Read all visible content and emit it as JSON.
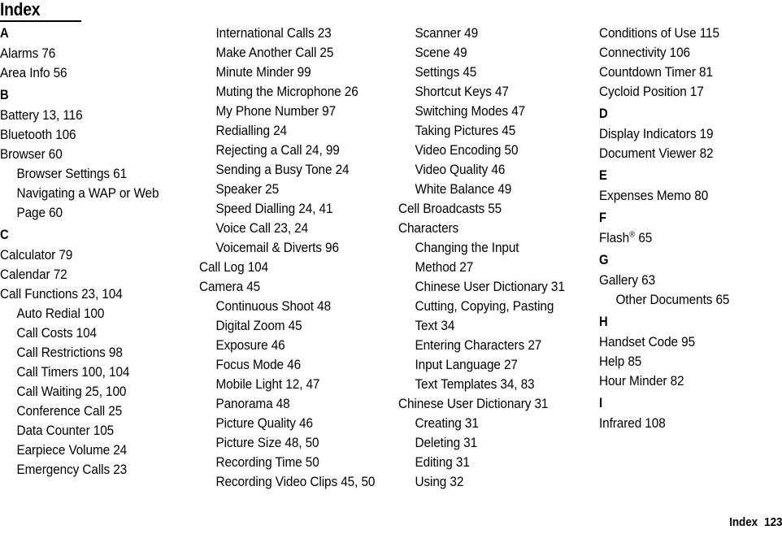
{
  "page": {
    "title": "Index",
    "footer_label": "Index",
    "footer_page": "123"
  },
  "columns": [
    {
      "id": "column-1",
      "blocks": [
        {
          "type": "letter",
          "text": "A"
        },
        {
          "type": "entry",
          "level": 0,
          "text": "Alarms 76"
        },
        {
          "type": "entry",
          "level": 0,
          "text": "Area Info 56"
        },
        {
          "type": "letter",
          "text": "B"
        },
        {
          "type": "entry",
          "level": 0,
          "text": "Battery 13, 116"
        },
        {
          "type": "entry",
          "level": 0,
          "text": "Bluetooth 106"
        },
        {
          "type": "entry",
          "level": 0,
          "text": "Browser 60"
        },
        {
          "type": "entry",
          "level": 1,
          "text": "Browser Settings 61"
        },
        {
          "type": "entry",
          "level": 1,
          "text": "Navigating a WAP or Web"
        },
        {
          "type": "entry",
          "level": 2,
          "text": "Page 60"
        },
        {
          "type": "letter",
          "text": "C"
        },
        {
          "type": "entry",
          "level": 0,
          "text": "Calculator 79"
        },
        {
          "type": "entry",
          "level": 0,
          "text": "Calendar 72"
        },
        {
          "type": "entry",
          "level": 0,
          "text": "Call Functions 23, 104"
        },
        {
          "type": "entry",
          "level": 1,
          "text": "Auto Redial 100"
        },
        {
          "type": "entry",
          "level": 1,
          "text": "Call Costs 104"
        },
        {
          "type": "entry",
          "level": 1,
          "text": "Call Restrictions 98"
        },
        {
          "type": "entry",
          "level": 1,
          "text": "Call Timers 100, 104"
        },
        {
          "type": "entry",
          "level": 1,
          "text": "Call Waiting 25, 100"
        },
        {
          "type": "entry",
          "level": 1,
          "text": "Conference Call 25"
        },
        {
          "type": "entry",
          "level": 1,
          "text": "Data Counter 105"
        },
        {
          "type": "entry",
          "level": 1,
          "text": "Earpiece Volume 24"
        },
        {
          "type": "entry",
          "level": 1,
          "text": "Emergency Calls 23"
        }
      ]
    },
    {
      "id": "column-2",
      "blocks": [
        {
          "type": "entry",
          "level": 1,
          "text": "International Calls 23"
        },
        {
          "type": "entry",
          "level": 1,
          "text": "Make Another Call 25"
        },
        {
          "type": "entry",
          "level": 1,
          "text": "Minute Minder 99"
        },
        {
          "type": "entry",
          "level": 1,
          "text": "Muting the Microphone 26"
        },
        {
          "type": "entry",
          "level": 1,
          "text": "My Phone Number 97"
        },
        {
          "type": "entry",
          "level": 1,
          "text": "Redialling 24"
        },
        {
          "type": "entry",
          "level": 1,
          "text": "Rejecting a Call 24, 99"
        },
        {
          "type": "entry",
          "level": 1,
          "text": "Sending a Busy Tone 24"
        },
        {
          "type": "entry",
          "level": 1,
          "text": "Speaker 25"
        },
        {
          "type": "entry",
          "level": 1,
          "text": "Speed Dialling 24, 41"
        },
        {
          "type": "entry",
          "level": 1,
          "text": "Voice Call 23, 24"
        },
        {
          "type": "entry",
          "level": 1,
          "text": "Voicemail & Diverts 96"
        },
        {
          "type": "entry",
          "level": 0,
          "text": "Call Log 104"
        },
        {
          "type": "entry",
          "level": 0,
          "text": "Camera 45"
        },
        {
          "type": "entry",
          "level": 1,
          "text": "Continuous Shoot 48"
        },
        {
          "type": "entry",
          "level": 1,
          "text": "Digital Zoom 45"
        },
        {
          "type": "entry",
          "level": 1,
          "text": "Exposure 46"
        },
        {
          "type": "entry",
          "level": 1,
          "text": "Focus Mode 46"
        },
        {
          "type": "entry",
          "level": 1,
          "text": "Mobile Light 12, 47"
        },
        {
          "type": "entry",
          "level": 1,
          "text": "Panorama 48"
        },
        {
          "type": "entry",
          "level": 1,
          "text": "Picture Quality 46"
        },
        {
          "type": "entry",
          "level": 1,
          "text": "Picture Size 48, 50"
        },
        {
          "type": "entry",
          "level": 1,
          "text": "Recording Time 50"
        },
        {
          "type": "entry",
          "level": 1,
          "text": "Recording Video Clips 45, 50"
        }
      ]
    },
    {
      "id": "column-3",
      "blocks": [
        {
          "type": "entry",
          "level": 1,
          "text": "Scanner 49"
        },
        {
          "type": "entry",
          "level": 1,
          "text": "Scene 49"
        },
        {
          "type": "entry",
          "level": 1,
          "text": "Settings 45"
        },
        {
          "type": "entry",
          "level": 1,
          "text": "Shortcut Keys 47"
        },
        {
          "type": "entry",
          "level": 1,
          "text": "Switching Modes 47"
        },
        {
          "type": "entry",
          "level": 1,
          "text": "Taking Pictures 45"
        },
        {
          "type": "entry",
          "level": 1,
          "text": "Video Encoding 50"
        },
        {
          "type": "entry",
          "level": 1,
          "text": "Video Quality 46"
        },
        {
          "type": "entry",
          "level": 1,
          "text": "White Balance 49"
        },
        {
          "type": "entry",
          "level": 0,
          "text": "Cell Broadcasts 55"
        },
        {
          "type": "entry",
          "level": 0,
          "text": "Characters"
        },
        {
          "type": "entry",
          "level": 1,
          "text": "Changing the Input"
        },
        {
          "type": "entry",
          "level": 2,
          "text": "Method 27"
        },
        {
          "type": "entry",
          "level": 1,
          "text": "Chinese User Dictionary 31"
        },
        {
          "type": "entry",
          "level": 1,
          "text": "Cutting, Copying, Pasting"
        },
        {
          "type": "entry",
          "level": 2,
          "text": "Text 34"
        },
        {
          "type": "entry",
          "level": 1,
          "text": "Entering Characters 27"
        },
        {
          "type": "entry",
          "level": 1,
          "text": "Input Language 27"
        },
        {
          "type": "entry",
          "level": 1,
          "text": "Text Templates 34, 83"
        },
        {
          "type": "entry",
          "level": 0,
          "text": "Chinese User Dictionary 31"
        },
        {
          "type": "entry",
          "level": 1,
          "text": "Creating 31"
        },
        {
          "type": "entry",
          "level": 1,
          "text": "Deleting 31"
        },
        {
          "type": "entry",
          "level": 1,
          "text": "Editing 31"
        },
        {
          "type": "entry",
          "level": 1,
          "text": "Using 32"
        }
      ]
    },
    {
      "id": "column-4",
      "blocks": [
        {
          "type": "entry",
          "level": 0,
          "text": "Conditions of Use 115"
        },
        {
          "type": "entry",
          "level": 0,
          "text": "Connectivity 106"
        },
        {
          "type": "entry",
          "level": 0,
          "text": "Countdown Timer 81"
        },
        {
          "type": "entry",
          "level": 0,
          "text": "Cycloid Position 17"
        },
        {
          "type": "letter",
          "text": "D"
        },
        {
          "type": "entry",
          "level": 0,
          "text": "Display Indicators 19"
        },
        {
          "type": "entry",
          "level": 0,
          "text": "Document Viewer 82"
        },
        {
          "type": "letter",
          "text": "E"
        },
        {
          "type": "entry",
          "level": 0,
          "text": "Expenses Memo 80"
        },
        {
          "type": "letter",
          "text": "F"
        },
        {
          "type": "entry",
          "level": 0,
          "html": "Flash<sup>®</sup> 65",
          "text": "Flash® 65"
        },
        {
          "type": "letter",
          "text": "G"
        },
        {
          "type": "entry",
          "level": 0,
          "text": "Gallery 63"
        },
        {
          "type": "entry",
          "level": 1,
          "text": "Other Documents 65"
        },
        {
          "type": "letter",
          "text": "H"
        },
        {
          "type": "entry",
          "level": 0,
          "text": "Handset Code 95"
        },
        {
          "type": "entry",
          "level": 0,
          "text": "Help 85"
        },
        {
          "type": "entry",
          "level": 0,
          "text": "Hour Minder 82"
        },
        {
          "type": "letter",
          "text": "I"
        },
        {
          "type": "entry",
          "level": 0,
          "text": "Infrared 108"
        }
      ]
    }
  ]
}
